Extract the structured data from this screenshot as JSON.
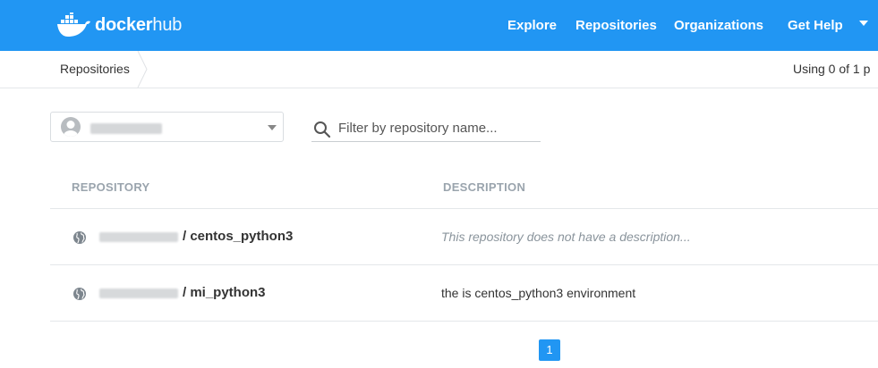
{
  "header": {
    "logo_word1": "docker",
    "logo_word2": "hub",
    "nav": [
      {
        "label": "Explore"
      },
      {
        "label": "Repositories"
      },
      {
        "label": "Organizations"
      },
      {
        "label": "Get Help"
      }
    ],
    "brand_color": "#2196f3"
  },
  "breadcrumb": {
    "label": "Repositories",
    "usage_text": "Using 0 of 1 p"
  },
  "filters": {
    "search_placeholder": "Filter by repository name..."
  },
  "table": {
    "columns": [
      "REPOSITORY",
      "DESCRIPTION"
    ],
    "rows": [
      {
        "name": "/ centos_python3",
        "description": "This repository does not have a description..."
      },
      {
        "name": "/ mi_python3",
        "description": "the is centos_python3 environment"
      }
    ]
  },
  "pagination": {
    "current": "1"
  },
  "icons": [
    "docker-whale-icon",
    "chevron-down-icon",
    "avatar-icon",
    "search-icon",
    "globe-icon"
  ]
}
